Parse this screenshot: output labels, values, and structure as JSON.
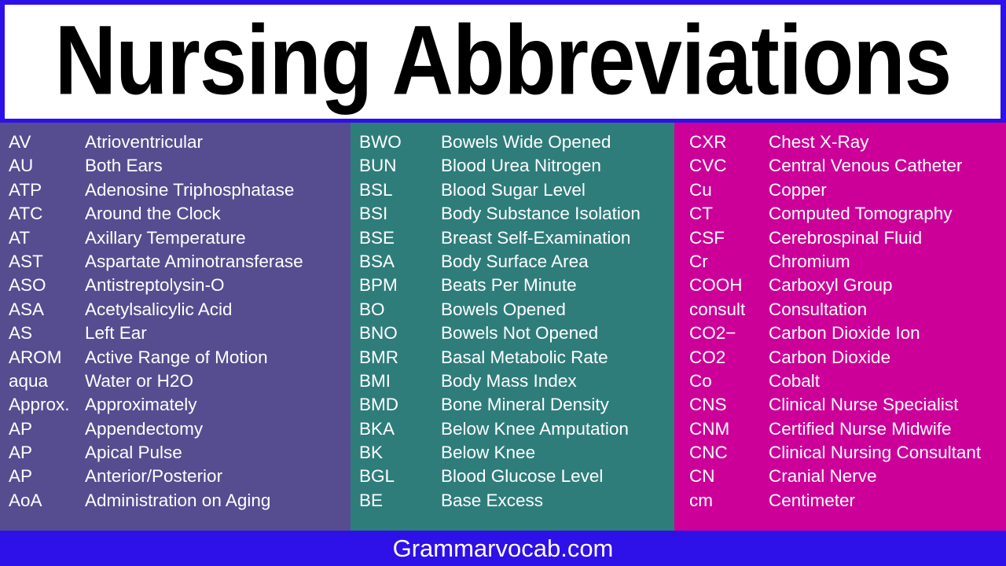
{
  "header": {
    "title": "Nursing Abbreviations",
    "border_color": "#2E10E8",
    "background_color": "#FFFFFF",
    "text_color": "#000000"
  },
  "footer": {
    "text": "Grammarvocab.com",
    "background_color": "#2E10E8",
    "text_color": "#FFFFFF"
  },
  "columns": [
    {
      "name": "column-a",
      "background_color": "#564D90",
      "text_color": "#FFFFFF",
      "rows": [
        {
          "abbr": "AV",
          "meaning": "Atrioventricular"
        },
        {
          "abbr": "AU",
          "meaning": "Both Ears"
        },
        {
          "abbr": "ATP",
          "meaning": "Adenosine Triphosphatase"
        },
        {
          "abbr": "ATC",
          "meaning": "Around the Clock"
        },
        {
          "abbr": "AT",
          "meaning": "Axillary Temperature"
        },
        {
          "abbr": "AST",
          "meaning": "Aspartate Aminotransferase"
        },
        {
          "abbr": "ASO",
          "meaning": "Antistreptolysin-O"
        },
        {
          "abbr": "ASA",
          "meaning": "Acetylsalicylic Acid"
        },
        {
          "abbr": "AS",
          "meaning": "Left Ear"
        },
        {
          "abbr": "AROM",
          "meaning": "Active Range of Motion"
        },
        {
          "abbr": "aqua",
          "meaning": "Water or H2O"
        },
        {
          "abbr": "Approx.",
          "meaning": "Approximately"
        },
        {
          "abbr": "AP",
          "meaning": "Appendectomy"
        },
        {
          "abbr": "AP",
          "meaning": "Apical Pulse"
        },
        {
          "abbr": "AP",
          "meaning": "Anterior/Posterior"
        },
        {
          "abbr": "AoA",
          "meaning": "Administration on Aging"
        }
      ]
    },
    {
      "name": "column-b",
      "background_color": "#2E7D7B",
      "text_color": "#FFFFFF",
      "rows": [
        {
          "abbr": "BWO",
          "meaning": "Bowels Wide Opened"
        },
        {
          "abbr": "BUN",
          "meaning": "Blood Urea Nitrogen"
        },
        {
          "abbr": "BSL",
          "meaning": "Blood Sugar Level"
        },
        {
          "abbr": "BSI",
          "meaning": "Body Substance Isolation"
        },
        {
          "abbr": "BSE",
          "meaning": "Breast Self-Examination"
        },
        {
          "abbr": "BSA",
          "meaning": "Body Surface Area"
        },
        {
          "abbr": "BPM",
          "meaning": "Beats Per Minute"
        },
        {
          "abbr": "BO",
          "meaning": "Bowels Opened"
        },
        {
          "abbr": "BNO",
          "meaning": "Bowels Not Opened"
        },
        {
          "abbr": "BMR",
          "meaning": "Basal Metabolic Rate"
        },
        {
          "abbr": "BMI",
          "meaning": "Body Mass Index"
        },
        {
          "abbr": "BMD",
          "meaning": "Bone Mineral Density"
        },
        {
          "abbr": "BKA",
          "meaning": "Below Knee Amputation"
        },
        {
          "abbr": "BK",
          "meaning": "Below Knee"
        },
        {
          "abbr": "BGL",
          "meaning": "Blood Glucose Level"
        },
        {
          "abbr": "BE",
          "meaning": "Base Excess"
        }
      ]
    },
    {
      "name": "column-c",
      "background_color": "#CC0099",
      "text_color": "#FFFFFF",
      "rows": [
        {
          "abbr": "CXR",
          "meaning": "Chest X-Ray"
        },
        {
          "abbr": "CVC",
          "meaning": "Central Venous Catheter"
        },
        {
          "abbr": "Cu",
          "meaning": "Copper"
        },
        {
          "abbr": "CT",
          "meaning": "Computed Tomography"
        },
        {
          "abbr": "CSF",
          "meaning": "Cerebrospinal Fluid"
        },
        {
          "abbr": "Cr",
          "meaning": "Chromium"
        },
        {
          "abbr": "COOH",
          "meaning": "Carboxyl Group"
        },
        {
          "abbr": "consult",
          "meaning": "Consultation"
        },
        {
          "abbr": "CO2−",
          "meaning": "Carbon Dioxide Ion"
        },
        {
          "abbr": "CO2",
          "meaning": "Carbon Dioxide"
        },
        {
          "abbr": "Co",
          "meaning": "Cobalt"
        },
        {
          "abbr": "CNS",
          "meaning": "Clinical Nurse Specialist"
        },
        {
          "abbr": "CNM",
          "meaning": "Certified Nurse Midwife"
        },
        {
          "abbr": "CNC",
          "meaning": "Clinical Nursing Consultant"
        },
        {
          "abbr": "CN",
          "meaning": "Cranial Nerve"
        },
        {
          "abbr": "cm",
          "meaning": "Centimeter"
        }
      ]
    }
  ]
}
